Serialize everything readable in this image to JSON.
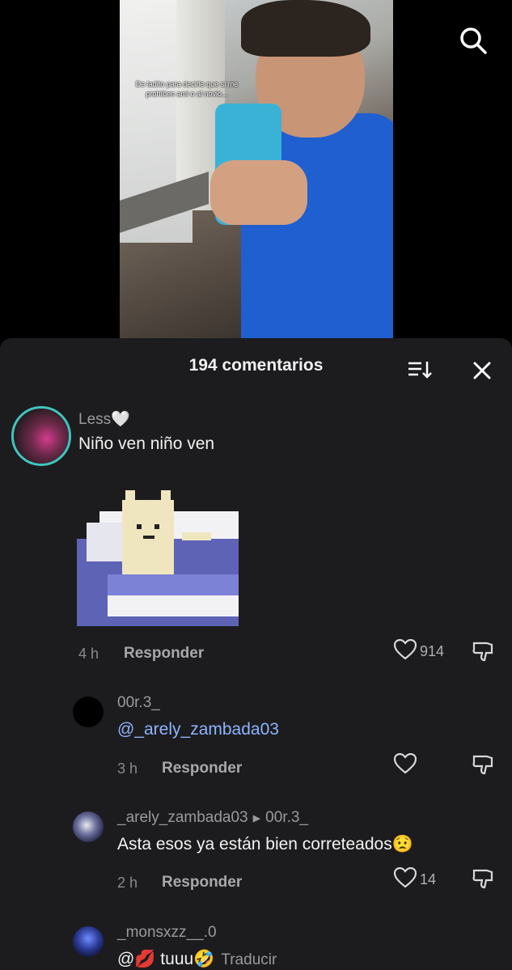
{
  "video": {
    "overlay_text": "De ladito para decirle que si me prohíben ami o al novio..."
  },
  "comments_sheet": {
    "title": "194 comentarios",
    "comments": [
      {
        "user": "Less🤍",
        "text": "Niño ven niño ven",
        "time": "4 h",
        "reply_label": "Responder",
        "likes": "914"
      },
      {
        "user": "00r.3_",
        "mention": "@_arely_zambada03",
        "time": "3 h",
        "reply_label": "Responder",
        "likes": ""
      },
      {
        "user": "_arely_zambada03",
        "reply_to_arrow": "▸",
        "reply_to": "00r.3_",
        "text": "Asta esos ya están bien correteados😟",
        "time": "2 h",
        "reply_label": "Responder",
        "likes": "14"
      },
      {
        "user": "_monsxzz__.0",
        "text_prefix": "@💋 tuuu🤣",
        "translate_label": "Traducir"
      }
    ]
  }
}
